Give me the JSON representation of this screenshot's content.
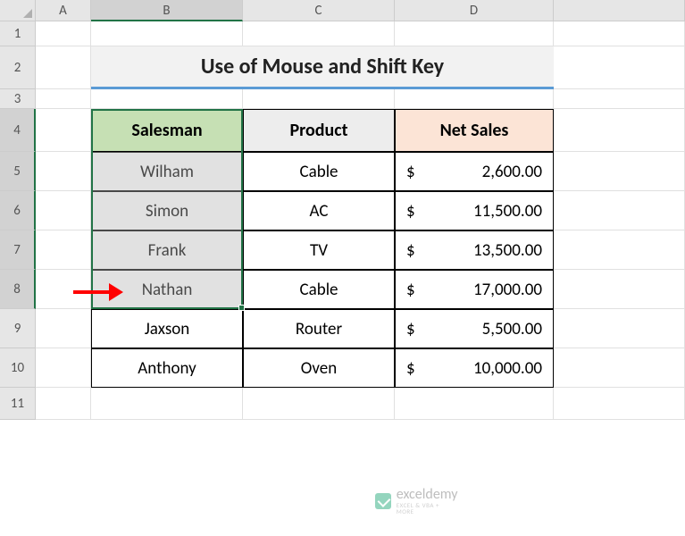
{
  "columns": [
    "A",
    "B",
    "C",
    "D"
  ],
  "rows": [
    "1",
    "2",
    "3",
    "4",
    "5",
    "6",
    "7",
    "8",
    "9",
    "10",
    "11"
  ],
  "title": "Use of Mouse and Shift Key",
  "headers": {
    "b": "Salesman",
    "c": "Product",
    "d": "Net Sales"
  },
  "currency": "$",
  "data": [
    {
      "salesman": "Wilham",
      "product": "Cable",
      "sales": "2,600.00"
    },
    {
      "salesman": "Simon",
      "product": "AC",
      "sales": "11,500.00"
    },
    {
      "salesman": "Frank",
      "product": "TV",
      "sales": "13,500.00"
    },
    {
      "salesman": "Nathan",
      "product": "Cable",
      "sales": "17,000.00"
    },
    {
      "salesman": "Jaxson",
      "product": "Router",
      "sales": "5,500.00"
    },
    {
      "salesman": "Anthony",
      "product": "Oven",
      "sales": "10,000.00"
    }
  ],
  "watermark": {
    "text": "exceldemy",
    "sub": "EXCEL & VBA + MORE"
  },
  "selection": {
    "range": "B4:B8",
    "active_cell": "B4"
  },
  "selected_col": "B",
  "selected_rows": [
    "4",
    "5",
    "6",
    "7",
    "8"
  ]
}
